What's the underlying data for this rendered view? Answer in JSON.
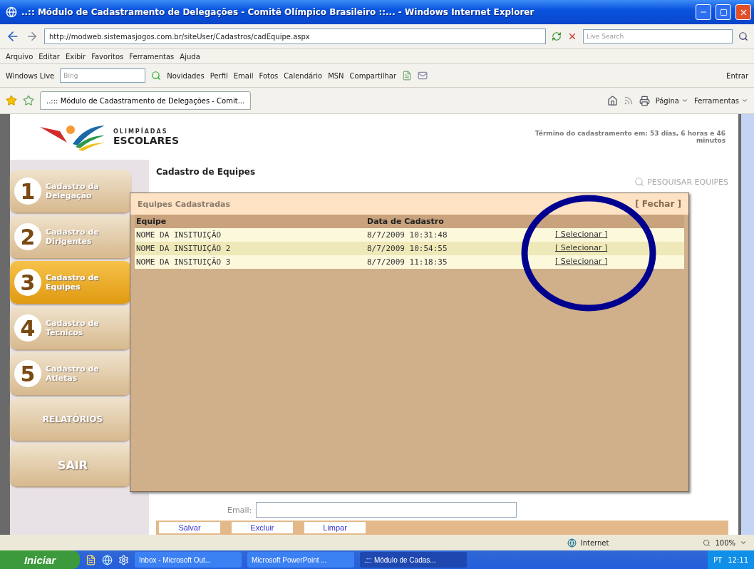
{
  "window": {
    "title": "..:: Módulo de Cadastramento de Delegações - Comitê Olímpico Brasileiro ::... - Windows Internet Explorer"
  },
  "address_bar": {
    "url": "http://modweb.sistemasjogos.com.br/siteUser/Cadastros/cadEquipe.aspx",
    "search_placeholder": "Live Search"
  },
  "menu": [
    "Arquivo",
    "Editar",
    "Exibir",
    "Favoritos",
    "Ferramentas",
    "Ajuda"
  ],
  "links_bar": {
    "brand": "Windows Live",
    "search_placeholder": "Bing",
    "items": [
      "Novidades",
      "Perfil",
      "Email",
      "Fotos",
      "Calendário",
      "MSN",
      "Compartilhar"
    ],
    "signin": "Entrar"
  },
  "tabs": [
    {
      "label": "..::: Módulo de Cadastramento de Delegações - Comit...",
      "selected": true
    }
  ],
  "command_bar": [
    "Página",
    "Ferramentas"
  ],
  "page": {
    "logo_top": "OLIMPÍADAS",
    "logo_bottom": "ESCOLARES",
    "deadline": "Término do cadastramento em: 53 dias, 6 horas e 46 minutos",
    "heading": "Cadastro de Equipes",
    "search_link": "PESQUISAR EQUIPES"
  },
  "sidebar": [
    {
      "kind": "step",
      "number": "1",
      "label": "Cadastro da Delegação",
      "selected": false
    },
    {
      "kind": "step",
      "number": "2",
      "label": "Cadastro de Dirigentes",
      "selected": false
    },
    {
      "kind": "step",
      "number": "3",
      "label": "Cadastro de Equipes",
      "selected": true
    },
    {
      "kind": "step",
      "number": "4",
      "label": "Cadastro de Técnicos",
      "selected": false
    },
    {
      "kind": "step",
      "number": "5",
      "label": "Cadastro de Atletas",
      "selected": false
    },
    {
      "kind": "plain",
      "label": "RELATÓRIOS",
      "selected": false
    },
    {
      "kind": "plain",
      "label": "SAIR",
      "selected": false
    }
  ],
  "form": {
    "email_label": "Email:",
    "buttons": [
      "Salvar",
      "Excluir",
      "Limpar"
    ]
  },
  "dialog": {
    "title": "Equipes Cadastradas",
    "close": "[ Fechar ]",
    "columns": [
      "Equipe",
      "Data de Cadastro"
    ],
    "rows": [
      {
        "team": "NOME DA INSITUIÇÃO",
        "date": "8/7/2009 10:31:48",
        "action": "[ Selecionar ]"
      },
      {
        "team": "NOME DA INSITUIÇÃO 2",
        "date": "8/7/2009 10:54:55",
        "action": "[ Selecionar ]"
      },
      {
        "team": "NOME DA INSITUIÇÃO 3",
        "date": "8/7/2009 11:18:35",
        "action": "[ Selecionar ]"
      }
    ]
  },
  "status_bar": {
    "zone": "Internet",
    "zoom": "100%"
  },
  "taskbar": {
    "start": "Iniciar",
    "tasks": [
      {
        "label": "Inbox - Microsoft Out...",
        "selected": false
      },
      {
        "label": "Microsoft PowerPoint ...",
        "selected": false
      },
      {
        "label": ".::: Módulo de Cadas...",
        "selected": true
      }
    ],
    "language": "PT",
    "clock": "12:11"
  }
}
